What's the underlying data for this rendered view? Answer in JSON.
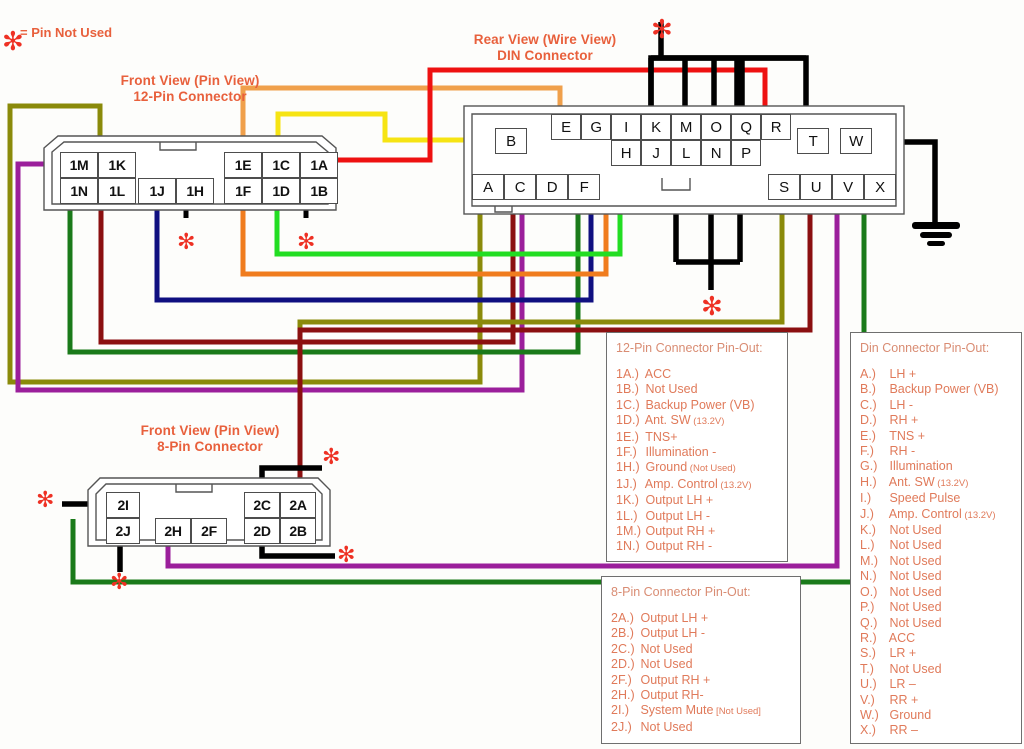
{
  "legend": {
    "asterisk": "✻",
    "text": "= Pin Not Used"
  },
  "titles": {
    "twelve_pin": {
      "line1": "Front View (Pin View)",
      "line2": "12-Pin Connector"
    },
    "eight_pin": {
      "line1": "Front View (Pin View)",
      "line2": "8-Pin Connector"
    },
    "din": {
      "line1": "Rear View (Wire View)",
      "line2": "DIN Connector"
    }
  },
  "connectors": {
    "twelve_pin": {
      "left_top": [
        "1M",
        "1K"
      ],
      "left_bottom": [
        "1N",
        "1L"
      ],
      "mid": [
        "1J",
        "1H"
      ],
      "right_top": [
        "1E",
        "1C",
        "1A"
      ],
      "right_bottom": [
        "1F",
        "1D",
        "1B"
      ]
    },
    "eight_pin": {
      "left_top": [
        "2I"
      ],
      "left_bottom": [
        "2J"
      ],
      "mid": [
        "2H",
        "2F"
      ],
      "right_top": [
        "2C",
        "2A"
      ],
      "right_bottom": [
        "2D",
        "2B"
      ]
    },
    "din": {
      "row_top": [
        "E",
        "G",
        "I",
        "K",
        "M",
        "O",
        "Q",
        "R"
      ],
      "row_second": [
        "H",
        "J",
        "L",
        "N",
        "P"
      ],
      "left_single": "B",
      "row_bottom_left": [
        "A",
        "C",
        "D",
        "F"
      ],
      "row_bottom_right": [
        "S",
        "U",
        "V",
        "X"
      ],
      "right_singles": [
        "T",
        "W"
      ]
    }
  },
  "pinouts": {
    "twelve": {
      "title": "12-Pin Connector Pin-Out:",
      "rows": [
        {
          "key": "1A.)",
          "desc": "ACC",
          "sub": ""
        },
        {
          "key": "1B.)",
          "desc": "Not Used",
          "sub": ""
        },
        {
          "key": "1C.)",
          "desc": "Backup Power (VB)",
          "sub": ""
        },
        {
          "key": "1D.)",
          "desc": "Ant. SW",
          "sub": "(13.2V)"
        },
        {
          "key": "1E.)",
          "desc": "TNS+",
          "sub": ""
        },
        {
          "key": "1F.)",
          "desc": "Illumination -",
          "sub": ""
        },
        {
          "key": "1H.)",
          "desc": "Ground",
          "sub": "(Not Used)"
        },
        {
          "key": "1J.)",
          "desc": "Amp. Control",
          "sub": "(13.2V)"
        },
        {
          "key": "1K.)",
          "desc": "Output LH +",
          "sub": ""
        },
        {
          "key": "1L.)",
          "desc": "Output LH -",
          "sub": ""
        },
        {
          "key": "1M.)",
          "desc": "Output RH +",
          "sub": ""
        },
        {
          "key": "1N.)",
          "desc": "Output RH -",
          "sub": ""
        }
      ]
    },
    "eight": {
      "title": "8-Pin Connector Pin-Out:",
      "rows": [
        {
          "key": "2A.)",
          "desc": "Output LH +",
          "sub": ""
        },
        {
          "key": "2B.)",
          "desc": "Output LH -",
          "sub": ""
        },
        {
          "key": "2C.)",
          "desc": "Not Used",
          "sub": ""
        },
        {
          "key": "2D.)",
          "desc": "Not Used",
          "sub": ""
        },
        {
          "key": "2F.)",
          "desc": "Output RH +",
          "sub": ""
        },
        {
          "key": "2H.)",
          "desc": "Output RH-",
          "sub": ""
        },
        {
          "key": "2I.)",
          "desc": "System Mute",
          "sub": "[Not Used]"
        },
        {
          "key": "2J.)",
          "desc": "Not Used",
          "sub": ""
        }
      ]
    },
    "din": {
      "title": "Din Connector Pin-Out:",
      "rows": [
        {
          "key": "A.)",
          "desc": "LH +",
          "sub": ""
        },
        {
          "key": "B.)",
          "desc": "Backup Power (VB)",
          "sub": ""
        },
        {
          "key": "C.)",
          "desc": "LH -",
          "sub": ""
        },
        {
          "key": "D.)",
          "desc": "RH +",
          "sub": ""
        },
        {
          "key": "E.)",
          "desc": "TNS +",
          "sub": ""
        },
        {
          "key": "F.)",
          "desc": "RH -",
          "sub": ""
        },
        {
          "key": "G.)",
          "desc": "Illumination",
          "sub": ""
        },
        {
          "key": "H.)",
          "desc": "Ant. SW",
          "sub": "(13.2V)"
        },
        {
          "key": "I.)",
          "desc": "Speed Pulse",
          "sub": ""
        },
        {
          "key": "J.)",
          "desc": "Amp. Control",
          "sub": "(13.2V)"
        },
        {
          "key": "K.)",
          "desc": "Not Used",
          "sub": ""
        },
        {
          "key": "L.)",
          "desc": "Not Used",
          "sub": ""
        },
        {
          "key": "M.)",
          "desc": "Not Used",
          "sub": ""
        },
        {
          "key": "N.)",
          "desc": "Not Used",
          "sub": ""
        },
        {
          "key": "O.)",
          "desc": "Not Used",
          "sub": ""
        },
        {
          "key": "P.)",
          "desc": "Not Used",
          "sub": ""
        },
        {
          "key": "Q.)",
          "desc": "Not Used",
          "sub": ""
        },
        {
          "key": "R.)",
          "desc": "ACC",
          "sub": ""
        },
        {
          "key": "S.)",
          "desc": "LR +",
          "sub": ""
        },
        {
          "key": "T.)",
          "desc": "Not Used",
          "sub": ""
        },
        {
          "key": "U.)",
          "desc": "LR –",
          "sub": ""
        },
        {
          "key": "V.)",
          "desc": "RR +",
          "sub": ""
        },
        {
          "key": "W.)",
          "desc": "Ground",
          "sub": ""
        },
        {
          "key": "X.)",
          "desc": "RR –",
          "sub": ""
        }
      ]
    }
  },
  "wire_colors": {
    "olive": "#8a8a0a",
    "purple": "#9b1f9b",
    "green_dark": "#1a7a1a",
    "maroon": "#8b1010",
    "navy": "#101080",
    "black": "#000000",
    "orange": "#f07c1e",
    "green_bright": "#22dd22",
    "yellow": "#f6e413",
    "red": "#ee1111",
    "magenta": "#a31aa3",
    "orange_light": "#f0a04b"
  }
}
